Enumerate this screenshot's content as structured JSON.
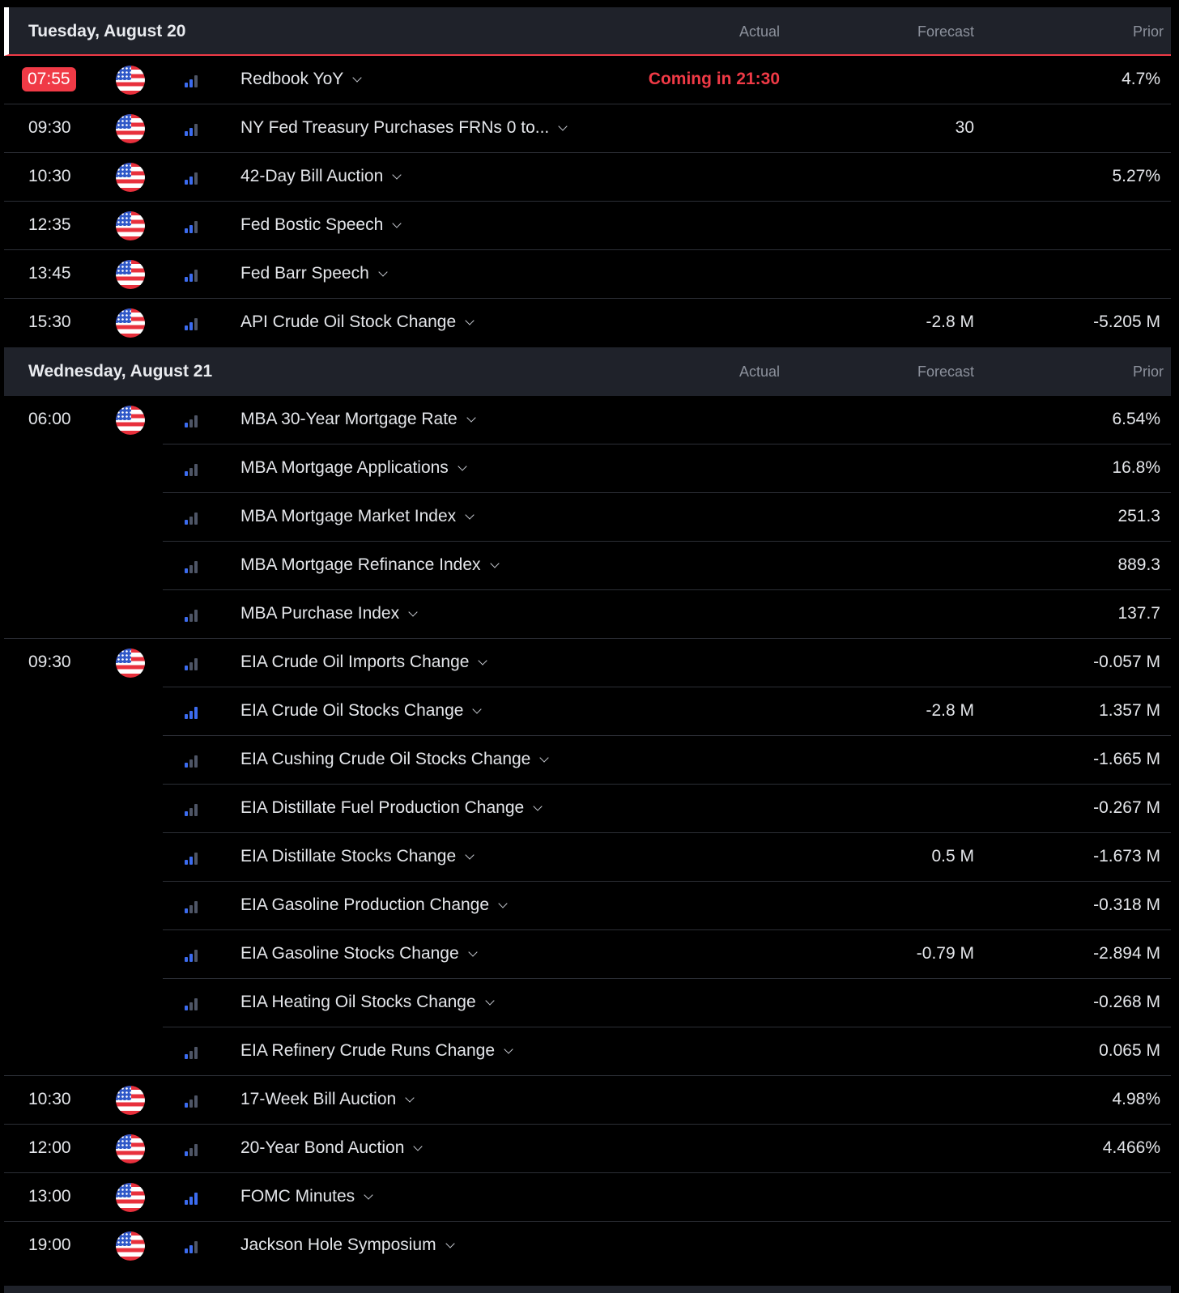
{
  "columns": {
    "actual": "Actual",
    "forecast": "Forecast",
    "prior": "Prior"
  },
  "days": [
    {
      "title": "Tuesday, August 20",
      "active": true,
      "events": [
        {
          "time": "07:55",
          "live": true,
          "countdown": "Coming in 21:30",
          "flag_icon": "us-flag-icon",
          "importance": 2,
          "name": "Redbook YoY",
          "actual": "",
          "forecast": "",
          "prior": "4.7%"
        },
        {
          "time": "09:30",
          "flag_icon": "us-flag-icon",
          "importance": 2,
          "name": "NY Fed Treasury Purchases FRNs 0 to...",
          "actual": "",
          "forecast": "30",
          "prior": ""
        },
        {
          "time": "10:30",
          "flag_icon": "us-flag-icon",
          "importance": 2,
          "name": "42-Day Bill Auction",
          "actual": "",
          "forecast": "",
          "prior": "5.27%"
        },
        {
          "time": "12:35",
          "flag_icon": "us-flag-icon",
          "importance": 2,
          "name": "Fed Bostic Speech",
          "actual": "",
          "forecast": "",
          "prior": ""
        },
        {
          "time": "13:45",
          "flag_icon": "us-flag-icon",
          "importance": 2,
          "name": "Fed Barr Speech",
          "actual": "",
          "forecast": "",
          "prior": ""
        },
        {
          "time": "15:30",
          "flag_icon": "us-flag-icon",
          "importance": 2,
          "name": "API Crude Oil Stock Change",
          "actual": "",
          "forecast": "-2.8 M",
          "prior": "-5.205 M"
        }
      ]
    },
    {
      "title": "Wednesday, August 21",
      "active": false,
      "events": [
        {
          "time": "06:00",
          "flag_icon": "us-flag-icon",
          "importance": 1,
          "name": "MBA 30-Year Mortgage Rate",
          "actual": "",
          "forecast": "",
          "prior": "6.54%"
        },
        {
          "time": "",
          "importance": 1,
          "name": "MBA Mortgage Applications",
          "actual": "",
          "forecast": "",
          "prior": "16.8%"
        },
        {
          "time": "",
          "importance": 1,
          "name": "MBA Mortgage Market Index",
          "actual": "",
          "forecast": "",
          "prior": "251.3"
        },
        {
          "time": "",
          "importance": 1,
          "name": "MBA Mortgage Refinance Index",
          "actual": "",
          "forecast": "",
          "prior": "889.3"
        },
        {
          "time": "",
          "importance": 1,
          "name": "MBA Purchase Index",
          "actual": "",
          "forecast": "",
          "prior": "137.7"
        },
        {
          "time": "09:30",
          "flag_icon": "us-flag-icon",
          "importance": 1,
          "name": "EIA Crude Oil Imports Change",
          "actual": "",
          "forecast": "",
          "prior": "-0.057 M"
        },
        {
          "time": "",
          "importance": 3,
          "name": "EIA Crude Oil Stocks Change",
          "actual": "",
          "forecast": "-2.8 M",
          "prior": "1.357 M"
        },
        {
          "time": "",
          "importance": 1,
          "name": "EIA Cushing Crude Oil Stocks Change",
          "actual": "",
          "forecast": "",
          "prior": "-1.665 M"
        },
        {
          "time": "",
          "importance": 1,
          "name": "EIA Distillate Fuel Production Change",
          "actual": "",
          "forecast": "",
          "prior": "-0.267 M"
        },
        {
          "time": "",
          "importance": 2,
          "name": "EIA Distillate Stocks Change",
          "actual": "",
          "forecast": "0.5 M",
          "prior": "-1.673 M"
        },
        {
          "time": "",
          "importance": 1,
          "name": "EIA Gasoline Production Change",
          "actual": "",
          "forecast": "",
          "prior": "-0.318 M"
        },
        {
          "time": "",
          "importance": 2,
          "name": "EIA Gasoline Stocks Change",
          "actual": "",
          "forecast": "-0.79 M",
          "prior": "-2.894 M"
        },
        {
          "time": "",
          "importance": 1,
          "name": "EIA Heating Oil Stocks Change",
          "actual": "",
          "forecast": "",
          "prior": "-0.268 M"
        },
        {
          "time": "",
          "importance": 1,
          "name": "EIA Refinery Crude Runs Change",
          "actual": "",
          "forecast": "",
          "prior": "0.065 M"
        },
        {
          "time": "10:30",
          "flag_icon": "us-flag-icon",
          "importance": 1,
          "name": "17-Week Bill Auction",
          "actual": "",
          "forecast": "",
          "prior": "4.98%"
        },
        {
          "time": "12:00",
          "flag_icon": "us-flag-icon",
          "importance": 1,
          "name": "20-Year Bond Auction",
          "actual": "",
          "forecast": "",
          "prior": "4.466%"
        },
        {
          "time": "13:00",
          "flag_icon": "us-flag-icon",
          "importance": 3,
          "name": "FOMC Minutes",
          "actual": "",
          "forecast": "",
          "prior": ""
        },
        {
          "time": "19:00",
          "flag_icon": "us-flag-icon",
          "importance": 2,
          "name": "Jackson Hole Symposium",
          "actual": "",
          "forecast": "",
          "prior": ""
        }
      ]
    }
  ],
  "colors": {
    "accent_red": "#f03a46",
    "importance_blue": "#3c6cf0",
    "header_bg": "#1f222a"
  }
}
